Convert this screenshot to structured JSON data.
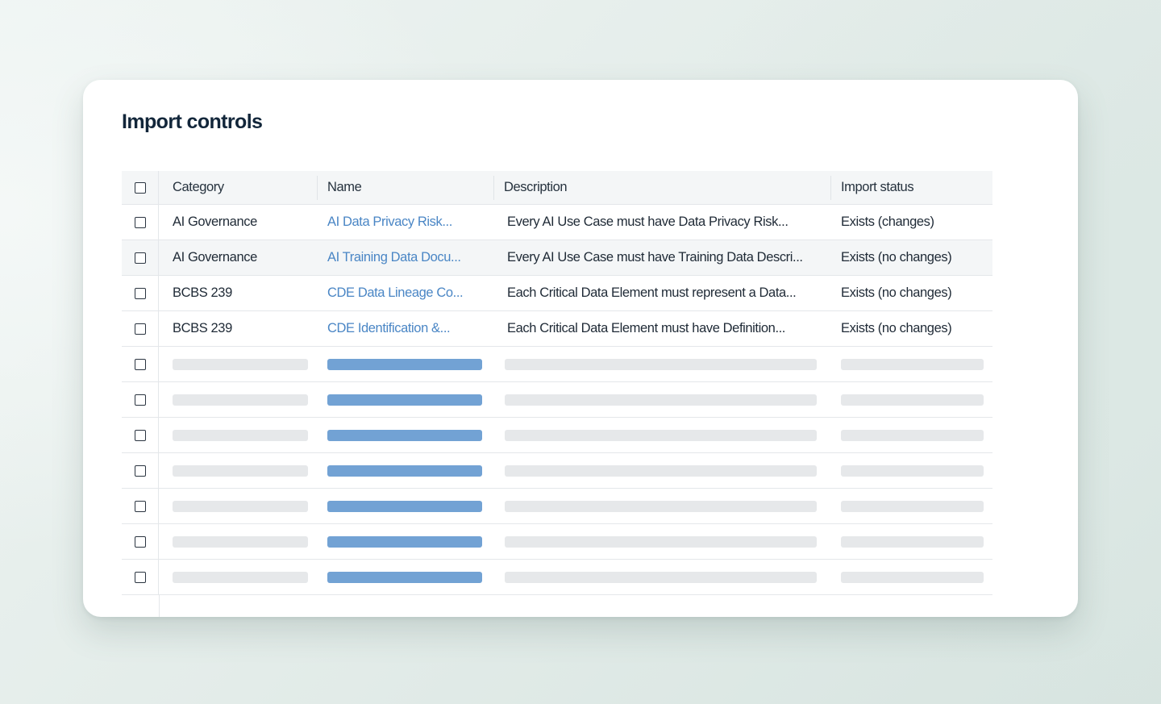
{
  "title": "Import controls",
  "table": {
    "columns": [
      "Category",
      "Name",
      "Description",
      "Import status"
    ],
    "rows": [
      {
        "category": "AI Governance",
        "name": "AI Data Privacy Risk...",
        "description": "Every AI Use Case must have Data Privacy Risk...",
        "status": "Exists (changes)"
      },
      {
        "category": "AI Governance",
        "name": "AI Training Data Docu...",
        "description": "Every AI Use Case must have Training Data Descri...",
        "status": "Exists (no changes)"
      },
      {
        "category": "BCBS 239",
        "name": "CDE Data Lineage Co...",
        "description": "Each Critical Data Element must represent a Data...",
        "status": "Exists (no changes)"
      },
      {
        "category": "BCBS 239",
        "name": "CDE Identification &...",
        "description": "Each Critical Data Element must have Definition...",
        "status": "Exists (no changes)"
      }
    ],
    "placeholder_rows": 7
  },
  "colors": {
    "title": "#12263a",
    "link": "#4a86c5",
    "placeholder_gray": "#e6e8ea",
    "placeholder_blue": "#72a2d4",
    "header_bg": "#f4f6f7"
  },
  "icons": {
    "checkbox": "checkbox-icon"
  }
}
